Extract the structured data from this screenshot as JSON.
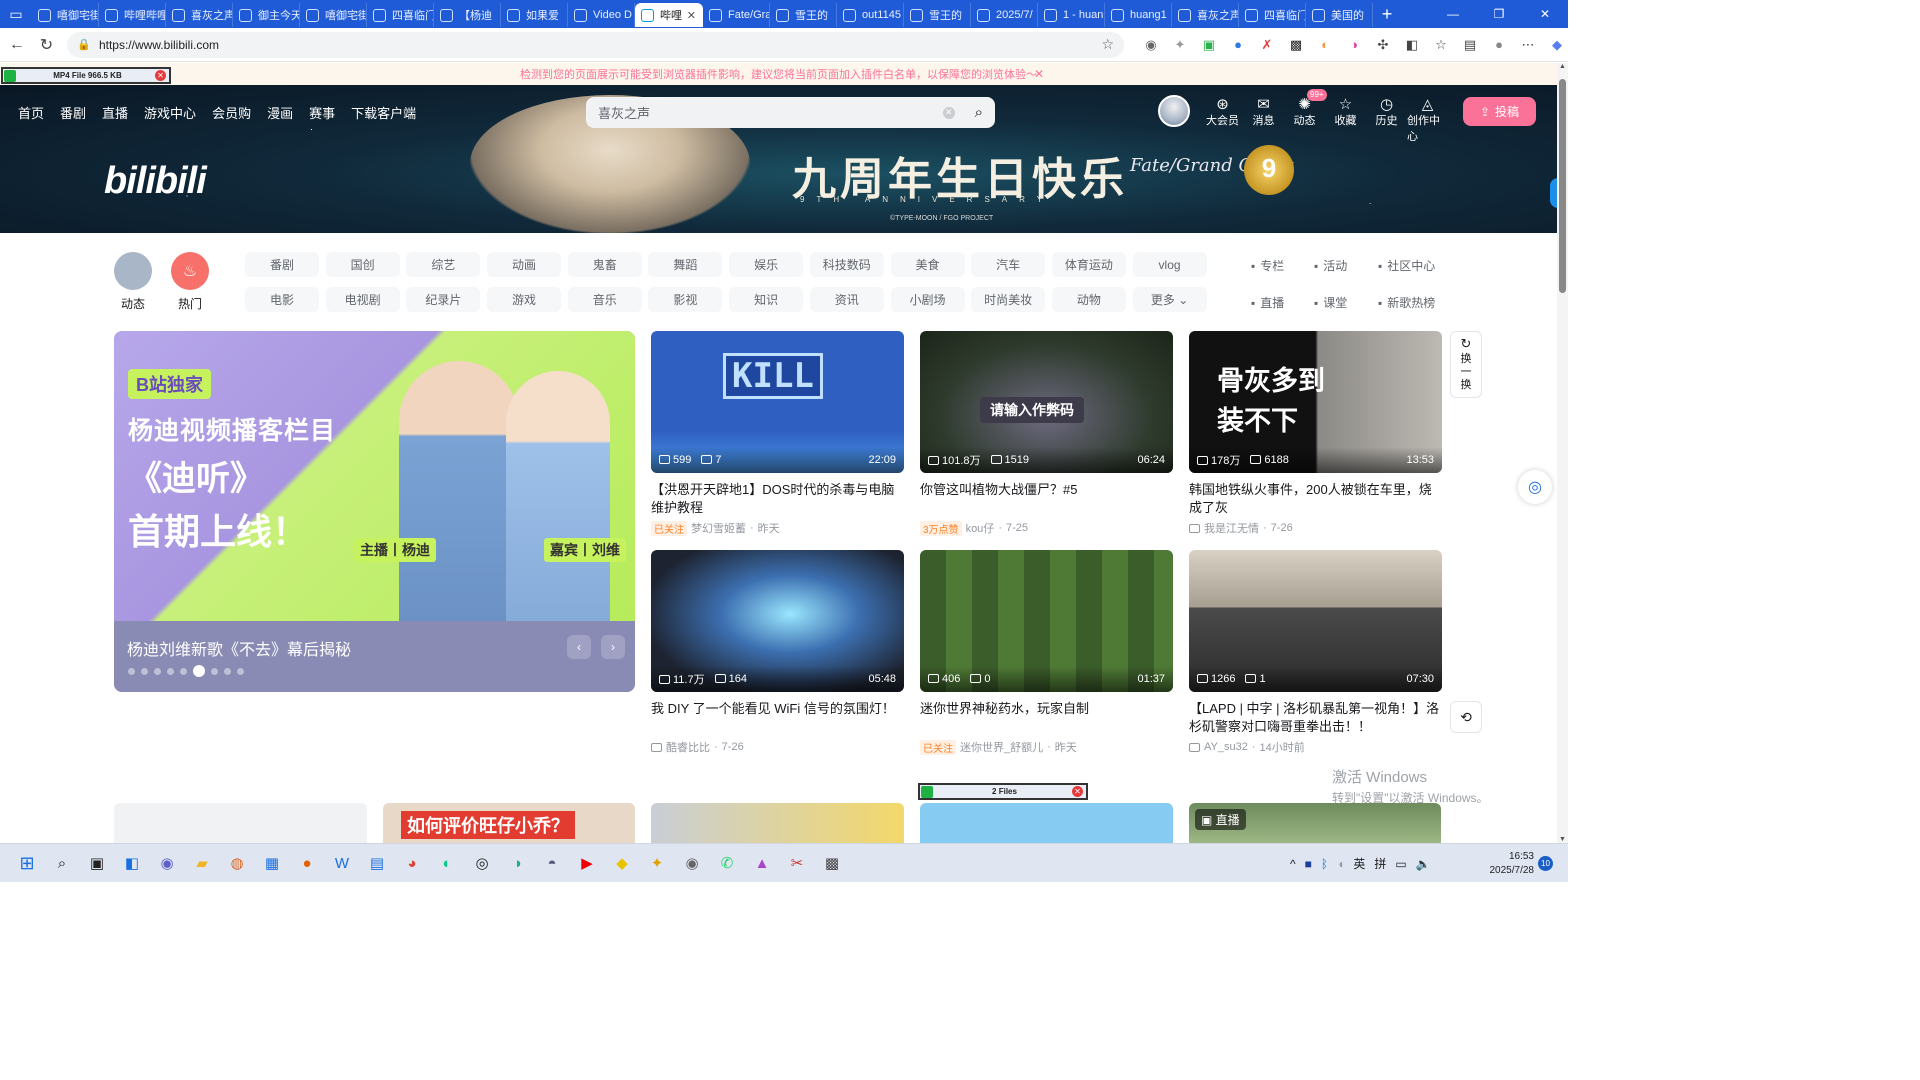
{
  "browser": {
    "tabs": [
      {
        "label": "嘻御宅街",
        "active": false
      },
      {
        "label": "哔哩哔哩",
        "active": false
      },
      {
        "label": "喜灰之声",
        "active": false
      },
      {
        "label": "御主今天",
        "active": false
      },
      {
        "label": "嘻御宅街",
        "active": false
      },
      {
        "label": "四喜临门",
        "active": false
      },
      {
        "label": "【杨迪",
        "active": false
      },
      {
        "label": "如果爱",
        "active": false
      },
      {
        "label": "Video D",
        "active": false
      },
      {
        "label": "哔哩",
        "active": true
      },
      {
        "label": "Fate/Gra",
        "active": false
      },
      {
        "label": "雪王的",
        "active": false
      },
      {
        "label": "out1145",
        "active": false
      },
      {
        "label": "雪王的",
        "active": false
      },
      {
        "label": "2025/7/",
        "active": false
      },
      {
        "label": "1 - huan",
        "active": false
      },
      {
        "label": "huang1",
        "active": false
      },
      {
        "label": "喜灰之声",
        "active": false
      },
      {
        "label": "四喜临门",
        "active": false
      },
      {
        "label": "美国的",
        "active": false
      }
    ],
    "url": "https://www.bilibili.com",
    "notice": "检测到您的页面展示可能受到浏览器插件影响，建议您将当前页面加入插件白名单，以保障您的浏览体验～",
    "download_chip": "MP4 File 966.5 KB",
    "files_chip": "2 Files"
  },
  "banner": {
    "logo": "bilibili",
    "headline": "九周年生日快乐",
    "subline": "9TH ANNIVERSARY",
    "copyright": "©TYPE-MOON / FGO PROJECT",
    "fgo_logo": "Fate/Grand Order",
    "nine": "9"
  },
  "topnav": {
    "left": [
      "首页",
      "番剧",
      "直播",
      "游戏中心",
      "会员购",
      "漫画",
      "赛事",
      "下载客户端"
    ],
    "search_placeholder": "喜灰之声",
    "right": [
      {
        "label": "大会员",
        "icon": "vip-icon"
      },
      {
        "label": "消息",
        "icon": "message-icon"
      },
      {
        "label": "动态",
        "icon": "dynamic-icon",
        "badge": "99+"
      },
      {
        "label": "收藏",
        "icon": "favorite-icon"
      },
      {
        "label": "历史",
        "icon": "history-icon"
      },
      {
        "label": "创作中心",
        "icon": "creator-icon"
      }
    ],
    "upload": "投稿"
  },
  "channels": {
    "featured": [
      {
        "label": "动态",
        "color": "#a9b6c7"
      },
      {
        "label": "热门",
        "color": "#f8706a"
      }
    ],
    "grid": [
      "番剧",
      "国创",
      "综艺",
      "动画",
      "鬼畜",
      "舞蹈",
      "娱乐",
      "科技数码",
      "美食",
      "汽车",
      "体育运动",
      "vlog",
      "电影",
      "电视剧",
      "纪录片",
      "游戏",
      "音乐",
      "影视",
      "知识",
      "资讯",
      "小剧场",
      "时尚美妆",
      "动物",
      "更多 ⌄"
    ],
    "side": [
      "专栏",
      "活动",
      "社区中心",
      "直播",
      "课堂",
      "新歌热榜"
    ]
  },
  "carousel": {
    "exclusive": "B站独家",
    "line1": "杨迪视频播客栏目",
    "line2": "《迪听》",
    "line3": "首期上线！",
    "host_tag": "主播丨杨迪",
    "guest_tag": "嘉宾丨刘维",
    "caption": "杨迪刘维新歌《不去》幕后揭秘",
    "dot_count": 9,
    "active_dot": 5
  },
  "videos": [
    {
      "plays": "599",
      "danmaku": "7",
      "duration": "22:09",
      "title": "【洪恩开天辟地1】DOS时代的杀毒与电脑维护教程",
      "tag": "已关注",
      "up": "梦幻雪姬蓄",
      "date": "昨天",
      "thumb": "KILL"
    },
    {
      "plays": "101.8万",
      "danmaku": "1519",
      "duration": "06:24",
      "title": "你管这叫植物大战僵尸？#5",
      "tag": "3万点赞",
      "up": "kou仔",
      "date": "7-25",
      "thumb": "请输入作弊码"
    },
    {
      "plays": "178万",
      "danmaku": "6188",
      "duration": "13:53",
      "title": "韩国地铁纵火事件，200人被锁在车里，烧成了灰",
      "tag": "",
      "up": "我是江无情",
      "date": "7-26",
      "thumb": "骨灰多到装不下"
    },
    {
      "plays": "11.7万",
      "danmaku": "164",
      "duration": "05:48",
      "title": "我 DIY 了一个能看见 WiFi 信号的氛围灯！",
      "tag": "",
      "up": "酷睿比比",
      "date": "7-26",
      "thumb": ""
    },
    {
      "plays": "406",
      "danmaku": "0",
      "duration": "01:37",
      "title": "迷你世界神秘药水，玩家自制",
      "tag": "已关注",
      "up": "迷你世界_舒额儿",
      "date": "昨天",
      "thumb": ""
    },
    {
      "plays": "1266",
      "danmaku": "1",
      "duration": "07:30",
      "title": "【LAPD | 中字 | 洛杉矶暴乱第一视角！】洛杉矶警察对口嗨哥重拳出击！！",
      "tag": "",
      "up": "AY_su32",
      "date": "14小时前",
      "thumb": ""
    }
  ],
  "refresh_label": "换一换",
  "bottom_row": {
    "thumb2_text": "如何评价旺仔小乔？",
    "live_tag": "直播"
  },
  "watermark": {
    "line1": "激活 Windows",
    "line2": "转到\"设置\"以激活 Windows。"
  },
  "taskbar": {
    "tray": [
      "^",
      "英",
      "拼"
    ],
    "time": "16:53",
    "date": "2025/7/28",
    "notifications": "10"
  }
}
